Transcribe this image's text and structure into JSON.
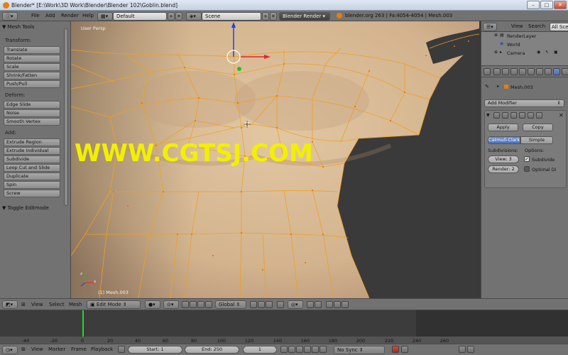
{
  "window": {
    "title": "Blender* [E:\\Work\\3D Work\\Blender\\Blender 102\\Goblin.blend]",
    "controls": [
      "–",
      "□",
      "✕"
    ]
  },
  "top_header": {
    "menus": [
      "File",
      "Add",
      "Render",
      "Help"
    ],
    "layout": "Default",
    "scene": "Scene",
    "engine": "Blender Render",
    "stats": "blender.org 263 | Fa:4054-4054 | Mesh.003"
  },
  "tool_panel": {
    "title": "Mesh Tools",
    "sections": [
      {
        "label": "Transform:",
        "buttons": [
          "Translate",
          "Rotate",
          "Scale",
          "Shrink/Fatten",
          "Push/Pull"
        ]
      },
      {
        "label": "Deform:",
        "buttons": [
          "Edge Slide",
          "Noise",
          "Smooth Vertex"
        ]
      },
      {
        "label": "Add:",
        "buttons": [
          "Extrude Region",
          "Extrude Individual",
          "Subdivide",
          "Loop Cut and Slide",
          "Duplicate",
          "Spin",
          "Screw"
        ]
      }
    ],
    "toggle": "Toggle Editmode"
  },
  "viewport": {
    "view_name": "User Persp",
    "object_label": "(1) Mesh.003",
    "watermark": "WWW.CGTSJ.COM"
  },
  "outliner": {
    "menus": [
      "View",
      "Search",
      "All Sce"
    ],
    "items": [
      "RenderLayer",
      "World",
      "Camera"
    ]
  },
  "properties": {
    "object_name": "Mesh.003",
    "add_modifier": "Add Modifier",
    "apply": "Apply",
    "copy": "Copy",
    "catmull": "Catmull-Clark",
    "simple": "Simple",
    "subdivisions_label": "Subdivisions:",
    "options_label": "Options:",
    "view_level": "View: 3",
    "render_level": "Render: 2",
    "opt1": "Subdivide",
    "opt2": "Optimal Di",
    "opt1_checked": true,
    "opt2_checked": false
  },
  "viewport_header": {
    "menus": [
      "View",
      "Select",
      "Mesh"
    ],
    "mode": "Edit Mode",
    "orientation": "Global"
  },
  "timeline": {
    "ticks": [
      "-40",
      "-20",
      "0",
      "20",
      "40",
      "60",
      "80",
      "100",
      "120",
      "140",
      "160",
      "180",
      "200",
      "220",
      "240",
      "260"
    ],
    "current_frame_marker": "0"
  },
  "timeline_header": {
    "menus": [
      "View",
      "Marker",
      "Frame",
      "Playback"
    ],
    "start": "Start: 1",
    "end": "End: 250",
    "frame": "1",
    "sync": "No Sync"
  },
  "colors": {
    "mesh_wire": "#f0a020",
    "skin": "#d9bc98",
    "watermark": "#f2f000",
    "panel": "#727272",
    "viewport_bg": "#3a3a3a"
  }
}
